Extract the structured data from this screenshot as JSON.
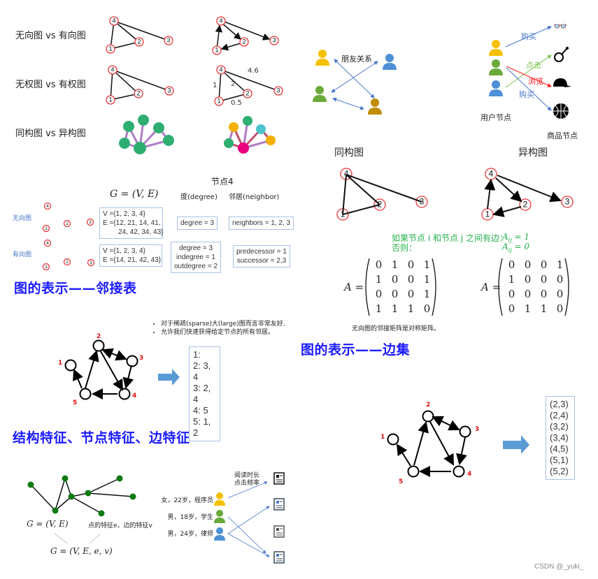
{
  "section1": {
    "row_labels": [
      "无向图  vs  有向图",
      "无权图  vs  有权图",
      "同构图  vs  异构图"
    ],
    "weights": {
      "w14": "1",
      "w24": "2",
      "w34": "4.6",
      "w12": "0.5"
    },
    "node_labels": [
      "1",
      "2",
      "3",
      "4"
    ]
  },
  "hetero_example": {
    "friend_label": "朋友关系",
    "buy_label_1": "购买",
    "click_label": "点击",
    "browse_label": "浏览",
    "buy_label_2": "购买",
    "user_nodes_label": "用户节点",
    "item_nodes_label": "商品节点",
    "homo_title": "同构图",
    "hetero_title": "异构图"
  },
  "adjacency_list_section": {
    "g_formula": "G = (V, E)",
    "node4_label": "节点4",
    "degree_header": "度(degree)",
    "neighbor_header": "邻居(neighbor)",
    "undirected_label": "无向图",
    "directed_label": "有向图",
    "undirected_V": "V ={1, 2, 3, 4}",
    "undirected_E1": "E ={12, 21, 14, 41,",
    "undirected_E2": "24, 42, 34, 43}",
    "directed_V": "V ={1, 2, 3, 4}",
    "directed_E": "E ={14, 21, 42, 43}",
    "undirected_degree": "degree = 3",
    "undirected_neighbors": "neighbors = 1, 2, 3",
    "directed_degree": "degree = 3",
    "directed_indegree": "indegree = 1",
    "directed_outdegree": "outdegree = 2",
    "predecessor": "predecessor = 1",
    "successor": "successor = 2,3",
    "heading": "图的表示——邻接表"
  },
  "matrix_section": {
    "rule_line1": "如果节点 i 和节点 j 之间有边：",
    "rule_val1": "A",
    "rule_eq1": " = 1",
    "rule_line2": "否则：",
    "rule_eq2": " = 0",
    "A_label": "A =",
    "undirected_matrix": [
      [
        0,
        1,
        0,
        1
      ],
      [
        1,
        0,
        0,
        1
      ],
      [
        0,
        0,
        0,
        1
      ],
      [
        1,
        1,
        1,
        0
      ]
    ],
    "directed_matrix": [
      [
        0,
        0,
        0,
        1
      ],
      [
        1,
        0,
        0,
        0
      ],
      [
        0,
        0,
        0,
        0
      ],
      [
        0,
        1,
        1,
        0
      ]
    ],
    "note": "无向图的邻接矩阵是对称矩阵。",
    "heading": "图的表示——边集"
  },
  "adj_list_example": {
    "bullets": [
      "对于稀疏(sparse)大(large)图而言非常友好,",
      "允许我们快速获得给定节点的所有邻居。"
    ],
    "list": [
      "1:",
      "2: 3, 4",
      "3: 2, 4",
      "4: 5",
      "5: 1, 2"
    ],
    "node_labels": [
      "1",
      "2",
      "3",
      "4",
      "5"
    ]
  },
  "edge_set_example": {
    "edges": [
      "(2,3)",
      "(2,4)",
      "(3,2)",
      "(3,4)",
      "(4,5)",
      "(5,1)",
      "(5,2)"
    ],
    "node_labels": [
      "1",
      "2",
      "3",
      "4",
      "5"
    ]
  },
  "features_section": {
    "heading": "结构特征、节点特征、边特征",
    "g_ve": "G = (V, E)",
    "feature_note": "点的特征e，边的特征v",
    "g_vee": "G = (V, E, e, v)",
    "edge_attr_line1": "阅读时长",
    "edge_attr_line2": "点击频率",
    "users": [
      "女，22岁，程序员",
      "男，18岁，学生",
      "男，24岁，律师"
    ]
  },
  "watermark": "CSDN @_yuki_",
  "colors": {
    "heading_blue": "#1a1aff",
    "node_red": "#e8383d",
    "green_node": "#0f7a0f",
    "arrow_blue": "#5b9bd5",
    "user_yellow": "#f5c000",
    "user_green": "#6aaa3a",
    "user_blue": "#4d90d6",
    "user_brown": "#c08c00"
  }
}
